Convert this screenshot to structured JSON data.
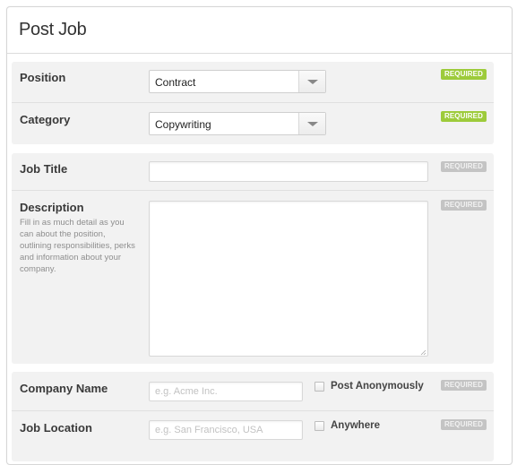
{
  "header": {
    "title": "Post Job"
  },
  "badges": {
    "required": "REQUIRED"
  },
  "colors": {
    "required_active": "#9dcb3b",
    "required_inactive": "#c4c4c4",
    "section_bg": "#f2f2f2"
  },
  "fields": {
    "position": {
      "label": "Position",
      "value": "Contract",
      "required_active": true
    },
    "category": {
      "label": "Category",
      "value": "Copywriting",
      "required_active": true
    },
    "job_title": {
      "label": "Job Title",
      "value": "",
      "placeholder": "",
      "required_active": false
    },
    "description": {
      "label": "Description",
      "help": "Fill in as much detail as you can about the position, outlining responsibilities, perks and information about your company.",
      "value": "",
      "required_active": false
    },
    "company_name": {
      "label": "Company Name",
      "value": "",
      "placeholder": "e.g. Acme Inc.",
      "checkbox_label": "Post Anonymously",
      "checkbox_checked": false,
      "required_active": false
    },
    "job_location": {
      "label": "Job Location",
      "value": "",
      "placeholder": "e.g. San Francisco, USA",
      "checkbox_label": "Anywhere",
      "checkbox_checked": false,
      "required_active": false
    }
  }
}
